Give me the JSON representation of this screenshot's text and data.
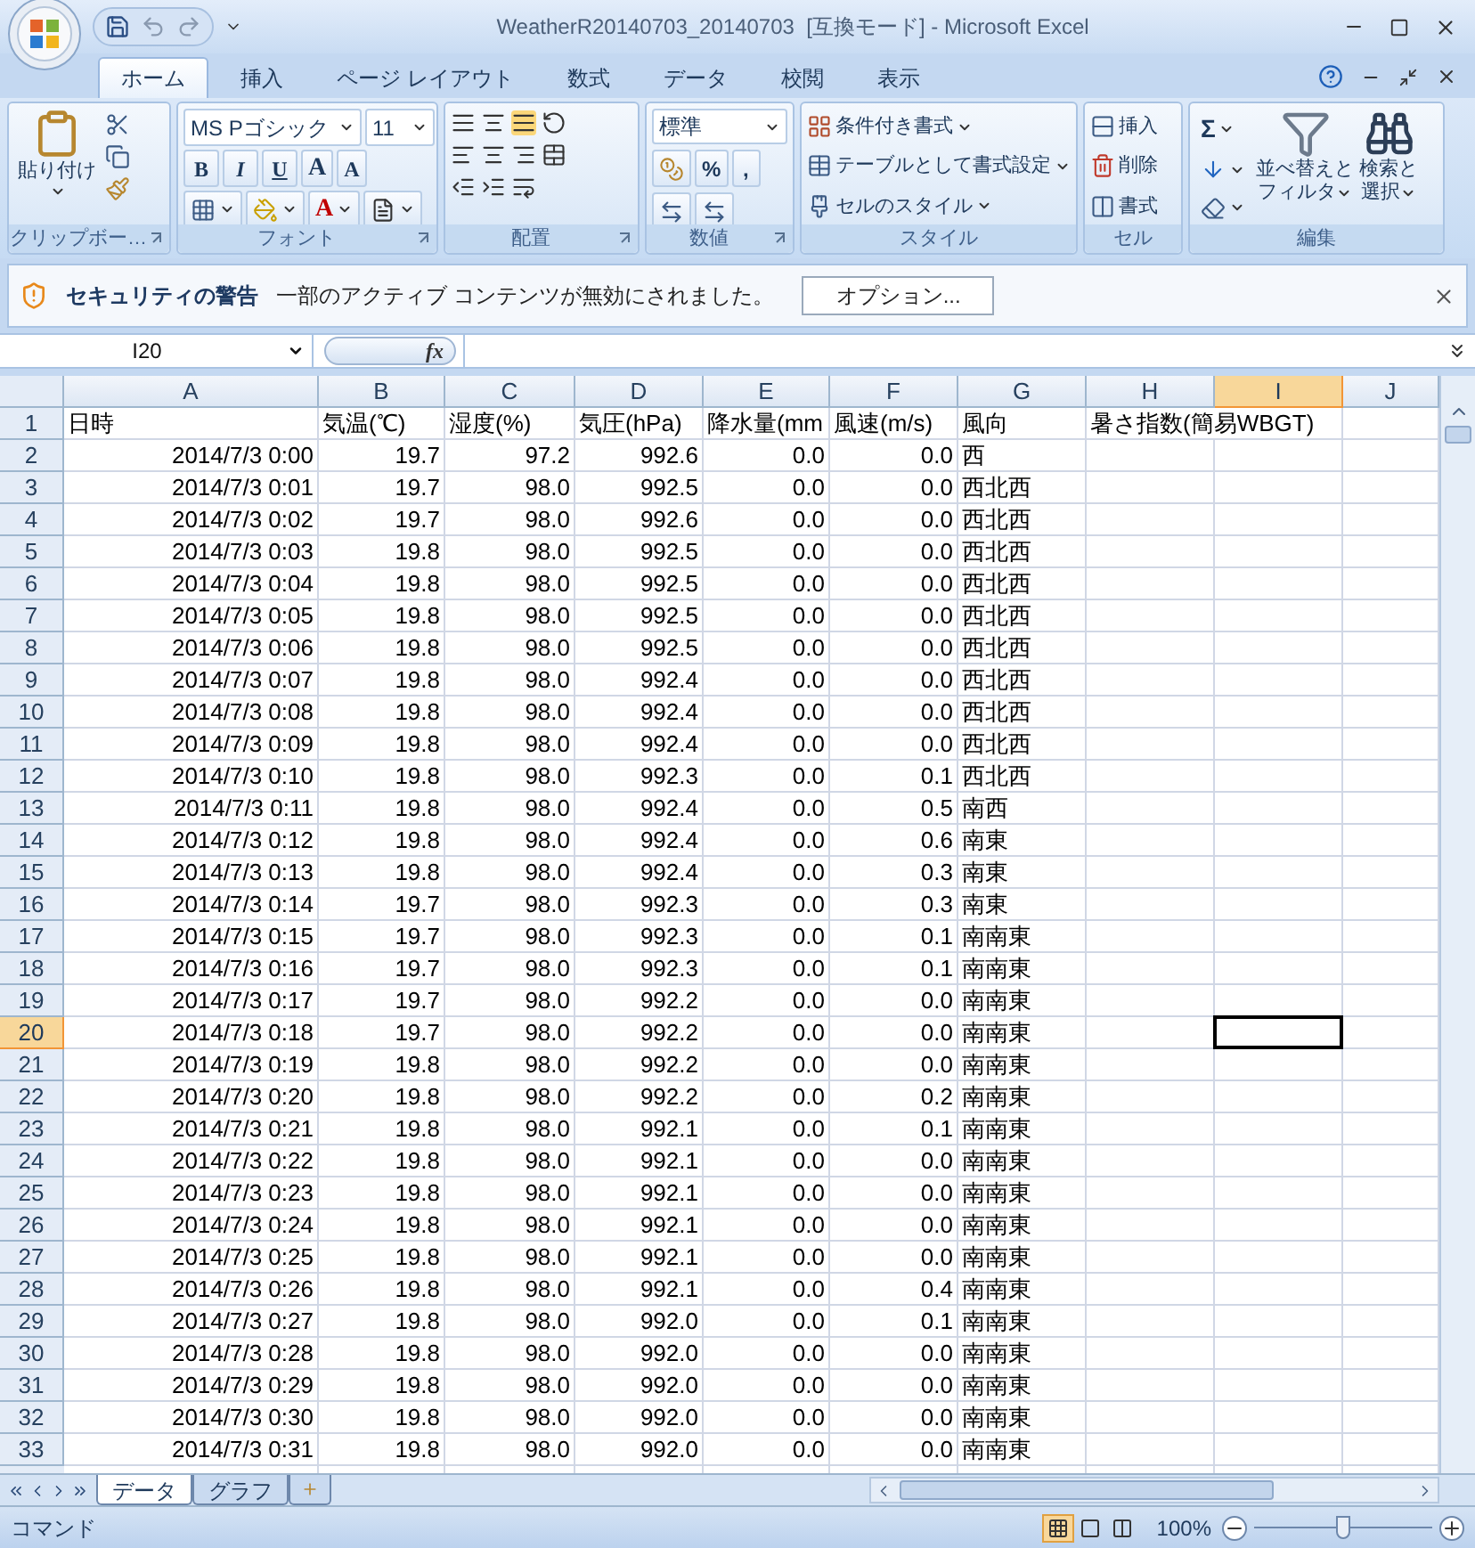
{
  "window": {
    "title": "WeatherR20140703_20140703  [互換モード] - Microsoft Excel"
  },
  "ribbon_tabs": [
    {
      "label": "ホーム",
      "selected": true
    },
    {
      "label": "挿入",
      "selected": false
    },
    {
      "label": "ページ レイアウト",
      "selected": false
    },
    {
      "label": "数式",
      "selected": false
    },
    {
      "label": "データ",
      "selected": false
    },
    {
      "label": "校閲",
      "selected": false
    },
    {
      "label": "表示",
      "selected": false
    }
  ],
  "clipboard": {
    "label": "クリップボー…",
    "paste": "貼り付け"
  },
  "font": {
    "label": "フォント",
    "font_name": "MS Pゴシック",
    "font_size": "11",
    "style_buttons": [
      "B",
      "I",
      "U"
    ],
    "grow": "A",
    "shrink": "A",
    "font_color": "A"
  },
  "alignment": {
    "label": "配置"
  },
  "number": {
    "label": "数値",
    "format": "標準",
    "percent": "%",
    "comma": ","
  },
  "styles": {
    "label": "スタイル",
    "buttons": [
      "条件付き書式",
      "テーブルとして書式設定",
      "セルのスタイル"
    ]
  },
  "cells": {
    "label": "セル",
    "buttons": [
      "挿入",
      "削除",
      "書式"
    ]
  },
  "editing": {
    "label": "編集",
    "sum": "Σ",
    "sort_filter": [
      "並べ替えと",
      "フィルタ"
    ],
    "find_select": [
      "検索と",
      "選択"
    ]
  },
  "security_bar": {
    "title": "セキュリティの警告",
    "message": "一部のアクティブ コンテンツが無効にされました。",
    "button": "オプション..."
  },
  "formula_bar": {
    "name_box": "I20",
    "fx": "fx"
  },
  "columns": [
    {
      "label": "A",
      "selected": false
    },
    {
      "label": "B",
      "selected": false
    },
    {
      "label": "C",
      "selected": false
    },
    {
      "label": "D",
      "selected": false
    },
    {
      "label": "E",
      "selected": false
    },
    {
      "label": "F",
      "selected": false
    },
    {
      "label": "G",
      "selected": false
    },
    {
      "label": "H",
      "selected": false
    },
    {
      "label": "I",
      "selected": true
    },
    {
      "label": "J",
      "selected": false
    }
  ],
  "rows": [
    {
      "number": "1",
      "kind": "header",
      "selected": false,
      "cells": [
        "日時",
        "気温(℃)",
        "湿度(%)",
        "気圧(hPa)",
        "降水量(mm",
        "風速(m/s)",
        "風向",
        "暑さ指数(簡易WBGT)"
      ]
    },
    {
      "number": "2",
      "kind": "data",
      "selected": false,
      "cells": [
        "2014/7/3 0:00",
        "19.7",
        "97.2",
        "992.6",
        "0.0",
        "0.0",
        "西"
      ]
    },
    {
      "number": "3",
      "kind": "data",
      "selected": false,
      "cells": [
        "2014/7/3 0:01",
        "19.7",
        "98.0",
        "992.5",
        "0.0",
        "0.0",
        "西北西"
      ]
    },
    {
      "number": "4",
      "kind": "data",
      "selected": false,
      "cells": [
        "2014/7/3 0:02",
        "19.7",
        "98.0",
        "992.6",
        "0.0",
        "0.0",
        "西北西"
      ]
    },
    {
      "number": "5",
      "kind": "data",
      "selected": false,
      "cells": [
        "2014/7/3 0:03",
        "19.8",
        "98.0",
        "992.5",
        "0.0",
        "0.0",
        "西北西"
      ]
    },
    {
      "number": "6",
      "kind": "data",
      "selected": false,
      "cells": [
        "2014/7/3 0:04",
        "19.8",
        "98.0",
        "992.5",
        "0.0",
        "0.0",
        "西北西"
      ]
    },
    {
      "number": "7",
      "kind": "data",
      "selected": false,
      "cells": [
        "2014/7/3 0:05",
        "19.8",
        "98.0",
        "992.5",
        "0.0",
        "0.0",
        "西北西"
      ]
    },
    {
      "number": "8",
      "kind": "data",
      "selected": false,
      "cells": [
        "2014/7/3 0:06",
        "19.8",
        "98.0",
        "992.5",
        "0.0",
        "0.0",
        "西北西"
      ]
    },
    {
      "number": "9",
      "kind": "data",
      "selected": false,
      "cells": [
        "2014/7/3 0:07",
        "19.8",
        "98.0",
        "992.4",
        "0.0",
        "0.0",
        "西北西"
      ]
    },
    {
      "number": "10",
      "kind": "data",
      "selected": false,
      "cells": [
        "2014/7/3 0:08",
        "19.8",
        "98.0",
        "992.4",
        "0.0",
        "0.0",
        "西北西"
      ]
    },
    {
      "number": "11",
      "kind": "data",
      "selected": false,
      "cells": [
        "2014/7/3 0:09",
        "19.8",
        "98.0",
        "992.4",
        "0.0",
        "0.0",
        "西北西"
      ]
    },
    {
      "number": "12",
      "kind": "data",
      "selected": false,
      "cells": [
        "2014/7/3 0:10",
        "19.8",
        "98.0",
        "992.3",
        "0.0",
        "0.1",
        "西北西"
      ]
    },
    {
      "number": "13",
      "kind": "data",
      "selected": false,
      "cells": [
        "2014/7/3 0:11",
        "19.8",
        "98.0",
        "992.4",
        "0.0",
        "0.5",
        "南西"
      ]
    },
    {
      "number": "14",
      "kind": "data",
      "selected": false,
      "cells": [
        "2014/7/3 0:12",
        "19.8",
        "98.0",
        "992.4",
        "0.0",
        "0.6",
        "南東"
      ]
    },
    {
      "number": "15",
      "kind": "data",
      "selected": false,
      "cells": [
        "2014/7/3 0:13",
        "19.8",
        "98.0",
        "992.4",
        "0.0",
        "0.3",
        "南東"
      ]
    },
    {
      "number": "16",
      "kind": "data",
      "selected": false,
      "cells": [
        "2014/7/3 0:14",
        "19.7",
        "98.0",
        "992.3",
        "0.0",
        "0.3",
        "南東"
      ]
    },
    {
      "number": "17",
      "kind": "data",
      "selected": false,
      "cells": [
        "2014/7/3 0:15",
        "19.7",
        "98.0",
        "992.3",
        "0.0",
        "0.1",
        "南南東"
      ]
    },
    {
      "number": "18",
      "kind": "data",
      "selected": false,
      "cells": [
        "2014/7/3 0:16",
        "19.7",
        "98.0",
        "992.3",
        "0.0",
        "0.1",
        "南南東"
      ]
    },
    {
      "number": "19",
      "kind": "data",
      "selected": false,
      "cells": [
        "2014/7/3 0:17",
        "19.7",
        "98.0",
        "992.2",
        "0.0",
        "0.0",
        "南南東"
      ]
    },
    {
      "number": "20",
      "kind": "data",
      "selected": true,
      "cells": [
        "2014/7/3 0:18",
        "19.7",
        "98.0",
        "992.2",
        "0.0",
        "0.0",
        "南南東"
      ]
    },
    {
      "number": "21",
      "kind": "data",
      "selected": false,
      "cells": [
        "2014/7/3 0:19",
        "19.8",
        "98.0",
        "992.2",
        "0.0",
        "0.0",
        "南南東"
      ]
    },
    {
      "number": "22",
      "kind": "data",
      "selected": false,
      "cells": [
        "2014/7/3 0:20",
        "19.8",
        "98.0",
        "992.2",
        "0.0",
        "0.2",
        "南南東"
      ]
    },
    {
      "number": "23",
      "kind": "data",
      "selected": false,
      "cells": [
        "2014/7/3 0:21",
        "19.8",
        "98.0",
        "992.1",
        "0.0",
        "0.1",
        "南南東"
      ]
    },
    {
      "number": "24",
      "kind": "data",
      "selected": false,
      "cells": [
        "2014/7/3 0:22",
        "19.8",
        "98.0",
        "992.1",
        "0.0",
        "0.0",
        "南南東"
      ]
    },
    {
      "number": "25",
      "kind": "data",
      "selected": false,
      "cells": [
        "2014/7/3 0:23",
        "19.8",
        "98.0",
        "992.1",
        "0.0",
        "0.0",
        "南南東"
      ]
    },
    {
      "number": "26",
      "kind": "data",
      "selected": false,
      "cells": [
        "2014/7/3 0:24",
        "19.8",
        "98.0",
        "992.1",
        "0.0",
        "0.0",
        "南南東"
      ]
    },
    {
      "number": "27",
      "kind": "data",
      "selected": false,
      "cells": [
        "2014/7/3 0:25",
        "19.8",
        "98.0",
        "992.1",
        "0.0",
        "0.0",
        "南南東"
      ]
    },
    {
      "number": "28",
      "kind": "data",
      "selected": false,
      "cells": [
        "2014/7/3 0:26",
        "19.8",
        "98.0",
        "992.1",
        "0.0",
        "0.4",
        "南南東"
      ]
    },
    {
      "number": "29",
      "kind": "data",
      "selected": false,
      "cells": [
        "2014/7/3 0:27",
        "19.8",
        "98.0",
        "992.0",
        "0.0",
        "0.1",
        "南南東"
      ]
    },
    {
      "number": "30",
      "kind": "data",
      "selected": false,
      "cells": [
        "2014/7/3 0:28",
        "19.8",
        "98.0",
        "992.0",
        "0.0",
        "0.0",
        "南南東"
      ]
    },
    {
      "number": "31",
      "kind": "data",
      "selected": false,
      "cells": [
        "2014/7/3 0:29",
        "19.8",
        "98.0",
        "992.0",
        "0.0",
        "0.0",
        "南南東"
      ]
    },
    {
      "number": "32",
      "kind": "data",
      "selected": false,
      "cells": [
        "2014/7/3 0:30",
        "19.8",
        "98.0",
        "992.0",
        "0.0",
        "0.0",
        "南南東"
      ]
    },
    {
      "number": "33",
      "kind": "data",
      "selected": false,
      "cells": [
        "2014/7/3 0:31",
        "19.8",
        "98.0",
        "992.0",
        "0.0",
        "0.0",
        "南南東"
      ]
    }
  ],
  "sheet_tabs": [
    {
      "label": "データ",
      "selected": true
    },
    {
      "label": "グラフ",
      "selected": false
    }
  ],
  "status_bar": {
    "mode": "コマンド",
    "view_buttons": [
      {
        "kind": "normal",
        "selected": true
      },
      {
        "kind": "page_layout",
        "selected": false
      },
      {
        "kind": "page_break",
        "selected": false
      }
    ],
    "zoom": {
      "label": "100%",
      "level": 0.5
    }
  }
}
